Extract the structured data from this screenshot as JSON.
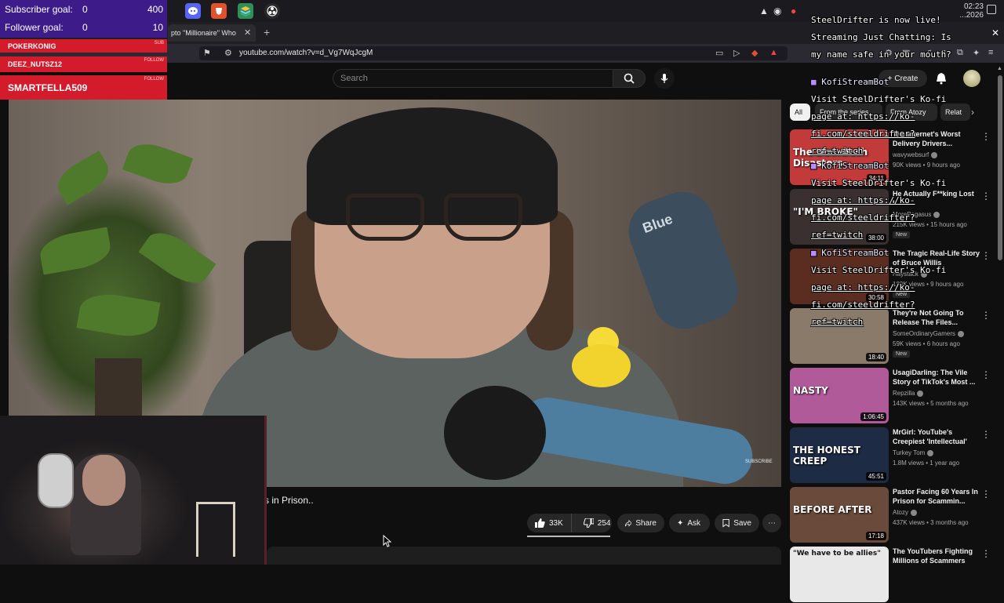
{
  "taskbar": {
    "clock_time": "02:23",
    "clock_date": "...2026"
  },
  "browser": {
    "active_tab_title": "pto \"Millionaire\" Who",
    "url": "youtube.com/watch?v=d_Vg7WqJcgM"
  },
  "youtube": {
    "search_placeholder": "Search",
    "create_label": "Create",
    "video_title_fragment": "s in Prison..",
    "actions": {
      "likes": "33K",
      "dislikes": "254",
      "share": "Share",
      "ask": "Ask",
      "save": "Save"
    },
    "video_watermark": "SUBSCRIBE",
    "mic_brand": "Blue"
  },
  "stream_widget": {
    "subscriber_goal_label": "Subscriber goal:",
    "subscriber_goal_current": "0",
    "subscriber_goal_target": "400",
    "follower_goal_label": "Follower goal:",
    "follower_goal_current": "0",
    "follower_goal_target": "10",
    "alerts": [
      {
        "name": "POKERKONIG",
        "tag": "SUB"
      },
      {
        "name": "DEEZ_NUTSZ12",
        "tag": "FOLLOW"
      },
      {
        "name": "SMARTFELLA509",
        "tag": "FOLLOW"
      }
    ]
  },
  "chips": [
    "All",
    "From the series",
    "From Atozy",
    "Relat"
  ],
  "recommendations": [
    {
      "title": "The Internet's Worst Delivery Drivers...",
      "channel": "wavywebsurf",
      "views": "90K views • 9 hours ago",
      "duration": "34:11",
      "new": "",
      "thumb_text": "The DoorDash Disasters",
      "thumb_color": "#c23a3a"
    },
    {
      "title": "He Actually F**king Lost It..",
      "channel": "MorePegasus",
      "views": "215K views • 15 hours ago",
      "duration": "38:00",
      "new": "New",
      "thumb_text": "\"I'M BROKE\"",
      "thumb_color": "#3a3030"
    },
    {
      "title": "The Tragic Real-Life Story of Bruce Willis",
      "channel": "Haystack",
      "views": "183K views • 9 hours ago",
      "duration": "30:58",
      "new": "New",
      "thumb_text": "",
      "thumb_color": "#5a2d20"
    },
    {
      "title": "They're Not Going To Release The Files...",
      "channel": "SomeOrdinaryGamers",
      "views": "59K views • 6 hours ago",
      "duration": "18:40",
      "new": "New",
      "thumb_text": "",
      "thumb_color": "#8a7a6a"
    },
    {
      "title": "UsagiDarling: The Vile Story of TikTok's Most ...",
      "channel": "Repzilla",
      "views": "143K views • 5 months ago",
      "duration": "1:06:45",
      "new": "",
      "thumb_text": "NASTY",
      "thumb_color": "#b05a9a"
    },
    {
      "title": "MrGirl: YouTube's Creepiest 'Intellectual'",
      "channel": "Turkey Tom",
      "views": "1.8M views • 1 year ago",
      "duration": "45:51",
      "new": "",
      "thumb_text": "THE HONEST CREEP",
      "thumb_color": "#1d2b44"
    },
    {
      "title": "Pastor Facing 60 Years In Prison for Scammin...",
      "channel": "Atozy",
      "views": "437K views • 3 months ago",
      "duration": "17:18",
      "new": "",
      "thumb_text": "BEFORE   AFTER",
      "thumb_color": "#6a4a3a"
    },
    {
      "title": "The YouTubers Fighting Millions of Scammers",
      "channel": "",
      "views": "",
      "duration": "",
      "new": "",
      "thumb_text": "\"We have to be allies\"",
      "thumb_color": "#e8e8e8"
    }
  ],
  "chat_overlay": {
    "lines": [
      "SteelDrifter is now live!",
      "Streaming Just Chatting: Is",
      "my name safe in your mouth?"
    ],
    "bot_name": "KofiStreamBot",
    "bot_message_1": "Visit SteelDrifter's Ko-fi",
    "bot_message_2": "page at: https://ko-",
    "bot_message_3": "fi.com/steeldrifter?",
    "bot_message_4": "ref=twitch"
  },
  "colors": {
    "goal_bg": "#3d1c8a",
    "alert_bg": "#d31b2c",
    "yt_bg": "#0f0f0f"
  }
}
